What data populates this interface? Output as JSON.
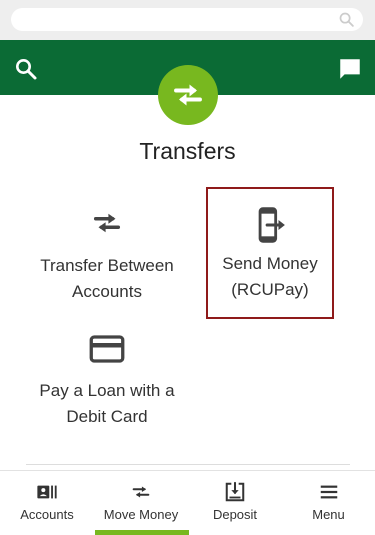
{
  "header": {
    "search_icon": "search-icon",
    "chat_icon": "chat-icon"
  },
  "page": {
    "title": "Transfers",
    "badge_icon": "swap-arrows-icon"
  },
  "tiles": [
    {
      "line1": "Transfer Between",
      "line2": "Accounts",
      "icon": "swap-arrows-icon"
    },
    {
      "line1": "Send Money",
      "line2": "(RCUPay)",
      "icon": "phone-send-icon",
      "highlighted": true
    },
    {
      "line1": "Pay a Loan with a",
      "line2": "Debit Card",
      "icon": "credit-card-icon"
    }
  ],
  "tabbar": {
    "tabs": [
      {
        "label": "Accounts",
        "icon": "accounts-icon"
      },
      {
        "label": "Move Money",
        "icon": "swap-arrows-icon",
        "active": true
      },
      {
        "label": "Deposit",
        "icon": "deposit-icon"
      },
      {
        "label": "Menu",
        "icon": "hamburger-menu-icon"
      }
    ]
  },
  "colors": {
    "header_green": "#0b6b35",
    "accent_lime": "#78b81f",
    "highlight_border": "#8f1a1a"
  }
}
